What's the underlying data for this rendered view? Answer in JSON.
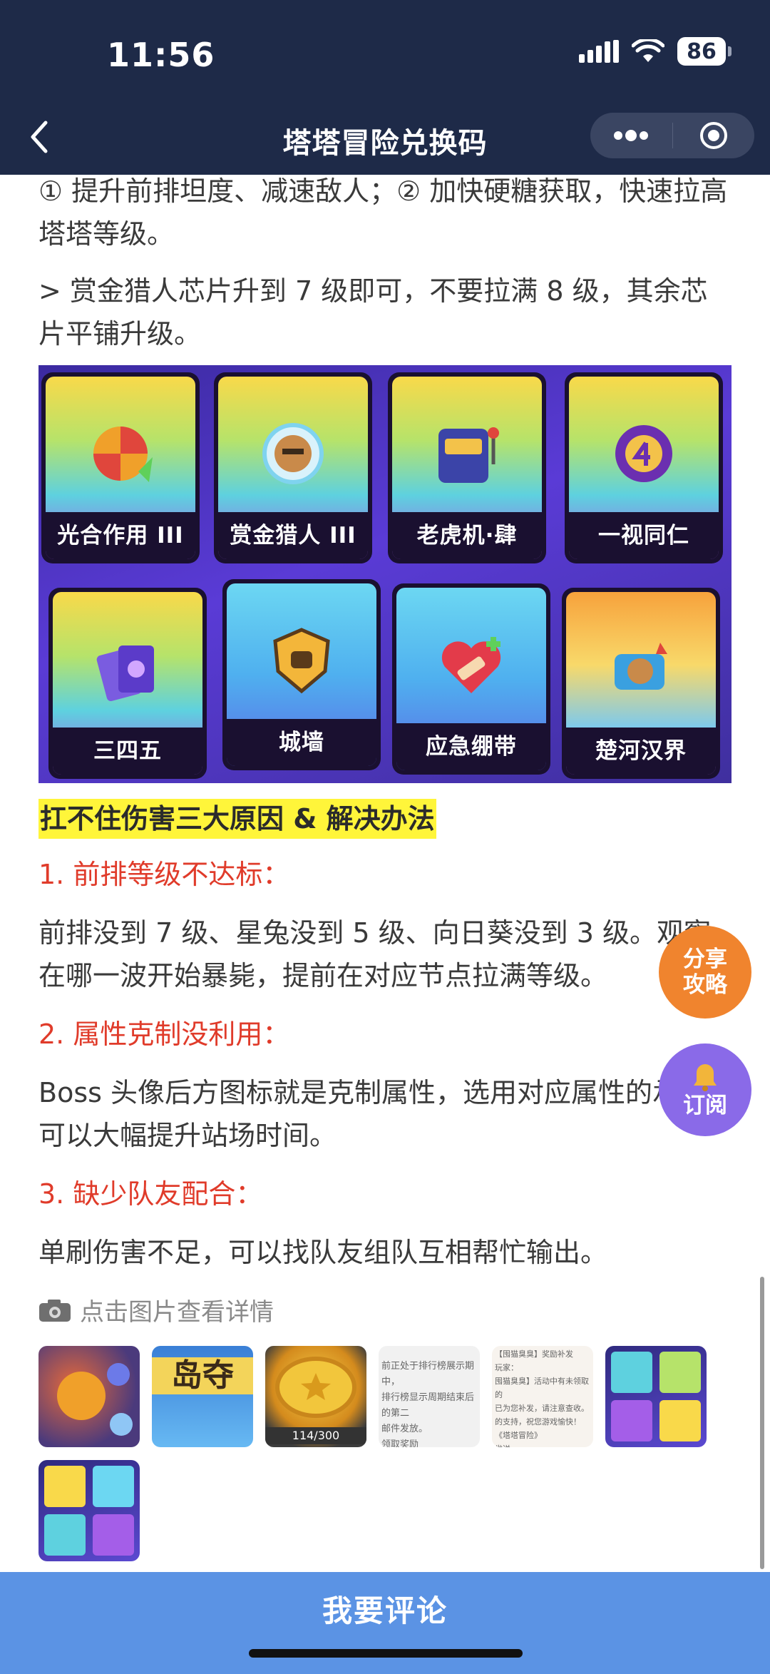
{
  "status_bar": {
    "time": "11:56",
    "battery": "86"
  },
  "nav": {
    "title": "塔塔冒险兑换码"
  },
  "article": {
    "para1": "① 提升前排坦度、减速敌人；② 加快硬糖获取，快速拉高塔塔等级。",
    "para2": "> 赏金猎人芯片升到 7 级即可，不要拉满 8 级，其余芯片平铺升级。",
    "chips": [
      {
        "label": "光合作用 III",
        "icon": "candy-swirl-icon"
      },
      {
        "label": "赏金猎人 III",
        "icon": "bounty-target-icon"
      },
      {
        "label": "老虎机·肆",
        "icon": "slot-machine-icon"
      },
      {
        "label": "一视同仁",
        "icon": "number-four-badge-icon"
      },
      {
        "label": "三四五",
        "icon": "cards-icon"
      },
      {
        "label": "城墙",
        "icon": "shield-wall-icon"
      },
      {
        "label": "应急绷带",
        "icon": "bandage-heart-icon"
      },
      {
        "label": "楚河汉界",
        "icon": "map-scroll-icon"
      }
    ],
    "highlight": "扛不住伤害三大原因 & 解决办法",
    "h1": "1. 前排等级不达标：",
    "p3": "前排没到 7 级、星兔没到 5 级、向日葵没到 3 级。观察在哪一波开始暴毙，提前在对应节点拉满等级。",
    "h2": "2. 属性克制没利用：",
    "p4": "Boss 头像后方图标就是克制属性，选用对应属性的承伤，可以大幅提升站场时间。",
    "h3": "3. 缺少队友配合：",
    "p5": "单刷伤害不足，可以找队友组队互相帮忙输出。",
    "image_hint": "点击图片查看详情",
    "thumbs": [
      {
        "icon": "game-art-icon"
      },
      {
        "icon": "island-banner-icon",
        "text": "岛夺"
      },
      {
        "icon": "gold-coin-icon",
        "text": "114/300"
      },
      {
        "icon": "notice-text-icon",
        "text": "前正处于排行榜展示期中，\n排行榜显示周期结束后的第二\n邮件发放。\n领取奖励\n，随时欢迎联系我们~"
      },
      {
        "icon": "reward-notice-icon",
        "text": "【囤猫臭臭】奖励补发\n玩家：\n囤猫臭臭】活动中有未领取的\n已为您补发，请注意查收。\n的支持，祝您游戏愉快！\n《塔塔冒险》\n发送"
      },
      {
        "icon": "chip-grid-icon"
      },
      {
        "icon": "chip-grid-icon"
      }
    ]
  },
  "fab": {
    "share_line1": "分享",
    "share_line2": "攻略",
    "subscribe": "订阅"
  },
  "bottom": {
    "comment": "我要评论"
  }
}
